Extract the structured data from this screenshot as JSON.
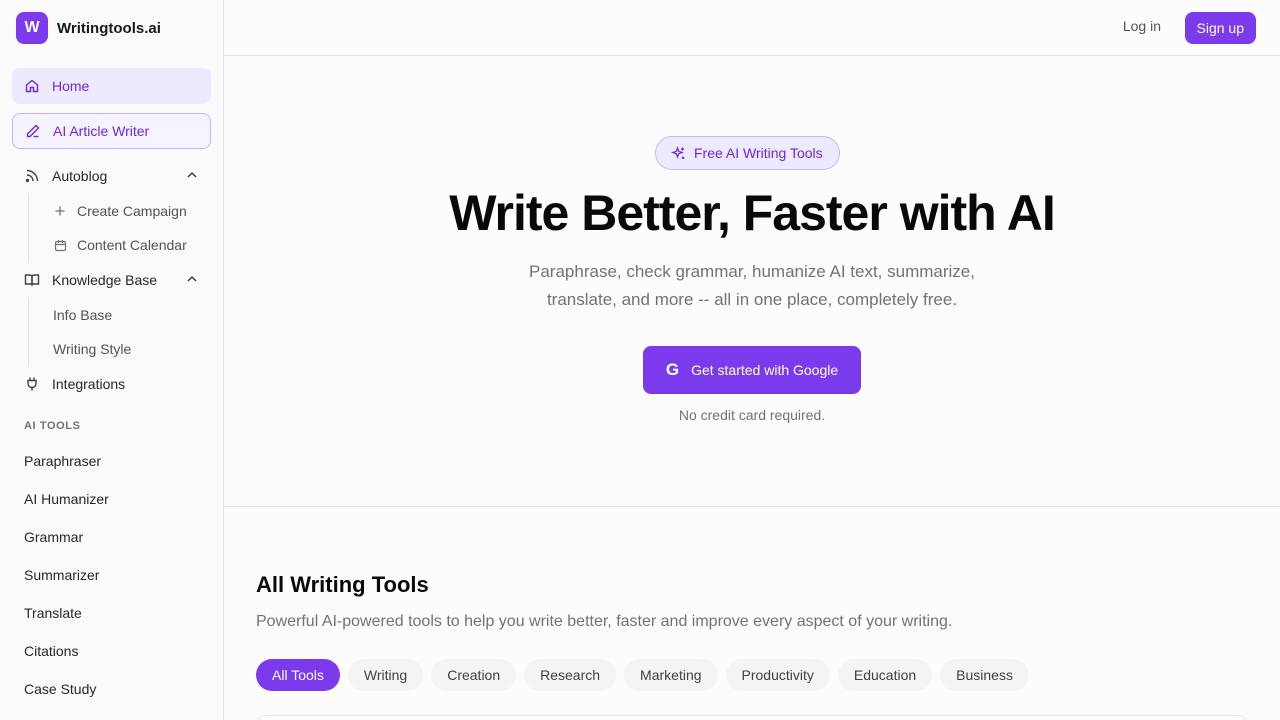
{
  "brand": {
    "logo_letter": "W",
    "name": "Writingtools.ai"
  },
  "sidebar": {
    "home": "Home",
    "article_writer": "AI Article Writer",
    "autoblog": {
      "label": "Autoblog",
      "items": [
        "Create Campaign",
        "Content Calendar"
      ]
    },
    "knowledge_base": {
      "label": "Knowledge Base",
      "items": [
        "Info Base",
        "Writing Style"
      ]
    },
    "integrations": "Integrations",
    "ai_tools_label": "AI TOOLS",
    "tools": [
      "Paraphraser",
      "AI Humanizer",
      "Grammar",
      "Summarizer",
      "Translate",
      "Citations",
      "Case Study"
    ]
  },
  "header": {
    "login": "Log in",
    "signup": "Sign up"
  },
  "hero": {
    "badge": "Free AI Writing Tools",
    "title": "Write Better, Faster with AI",
    "subtitle": "Paraphrase, check grammar, humanize AI text, summarize, translate, and more -- all in one place, completely free.",
    "cta_icon": "G",
    "cta": "Get started with Google",
    "note": "No credit card required."
  },
  "tools_section": {
    "title": "All Writing Tools",
    "description": "Powerful AI-powered tools to help you write better, faster and improve every aspect of your writing.",
    "filters": [
      "All Tools",
      "Writing",
      "Creation",
      "Research",
      "Marketing",
      "Productivity",
      "Education",
      "Business"
    ],
    "active_filter": "All Tools"
  },
  "colors": {
    "accent": "#7c3aed",
    "accent_light": "#ede9fe"
  }
}
